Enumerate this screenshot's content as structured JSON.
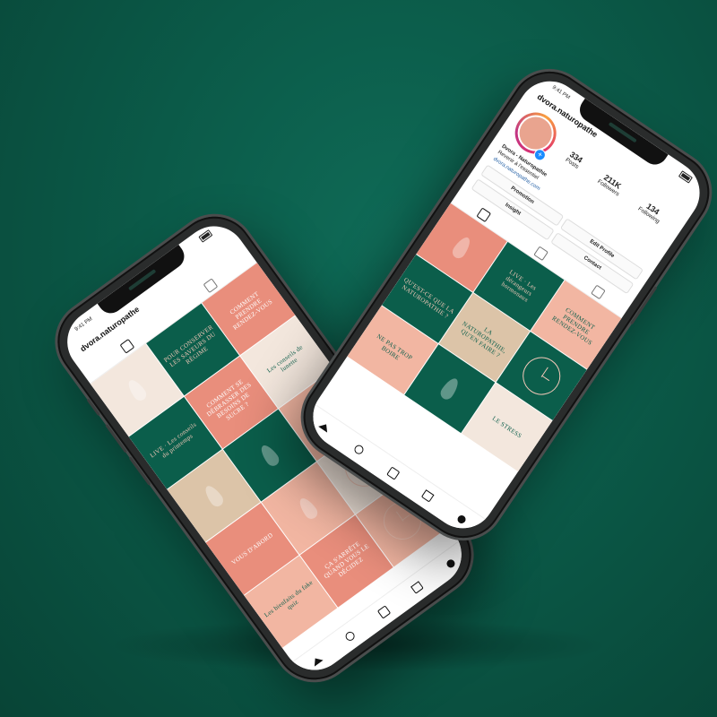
{
  "colors": {
    "background": "#0b5a48",
    "brand_green": "#0b5e4b",
    "salmon": "#e98e7c",
    "peach": "#f2b6a2"
  },
  "front_phone": {
    "status_time": "9:41 PM",
    "username": "dvora.naturopathe",
    "stats": [
      {
        "value": "334",
        "label": "Posts"
      },
      {
        "value": "211K",
        "label": "Followers"
      },
      {
        "value": "134",
        "label": "Following"
      }
    ],
    "bio_name": "Dvora - Naturopathie",
    "bio_line": "Revenir à l'essentiel",
    "bio_link": "dvora.naturopathe.com",
    "buttons": {
      "promotion": "Promotion",
      "edit_profile": "Edit Profile",
      "insight": "Insight",
      "contact": "Contact"
    },
    "tiles": [
      {
        "style": "t-salmon",
        "text": ""
      },
      {
        "style": "t-green",
        "text": "LIVE · Les dérangeurs hormonaux"
      },
      {
        "style": "t-peach",
        "text": "COMMENT PRENDRE RENDEZ-VOUS"
      },
      {
        "style": "t-green",
        "text": "QU'EST-CE QUE LA NATUROPATHIE ?"
      },
      {
        "style": "t-beige",
        "text": "LA NATUROPATHIE, QU'EN FAIRE ?"
      },
      {
        "style": "t-green",
        "text": ""
      },
      {
        "style": "t-peach",
        "text": "NE PAS TROP BOIRE"
      },
      {
        "style": "t-green",
        "text": ""
      },
      {
        "style": "t-light",
        "text": "LE STRESS"
      }
    ],
    "icons": [
      "home-icon",
      "search-icon",
      "reels-icon",
      "shop-icon",
      "profile-icon"
    ]
  },
  "back_phone": {
    "status_time": "9:41 PM",
    "username": "dvora.naturopathe",
    "tiles": [
      {
        "style": "t-light",
        "text": ""
      },
      {
        "style": "t-green",
        "text": "POUR CONSERVER LES SAVEURS DU RÉGIME"
      },
      {
        "style": "t-salmon",
        "text": "COMMENT PRENDRE RENDEZ-VOUS"
      },
      {
        "style": "t-green",
        "text": "LIVE · Les conseils du printemps"
      },
      {
        "style": "t-salmon",
        "text": "COMMENT SE DÉBRASSER DES BESOINS DE SUCRE ?"
      },
      {
        "style": "t-light",
        "text": "Les conseils de lunette"
      },
      {
        "style": "t-beige",
        "text": ""
      },
      {
        "style": "t-green",
        "text": ""
      },
      {
        "style": "t-peach",
        "text": ""
      },
      {
        "style": "t-salmon",
        "text": "VOUS D'ABORD"
      },
      {
        "style": "t-peach",
        "text": ""
      },
      {
        "style": "t-light",
        "text": ""
      },
      {
        "style": "t-peach",
        "text": "Les bienfaits du fake quiz"
      },
      {
        "style": "t-salmon",
        "text": "ÇA S'ARRÊTE QUAND VOUS LE DÉCIDEZ"
      },
      {
        "style": "t-peach",
        "text": ""
      }
    ]
  }
}
